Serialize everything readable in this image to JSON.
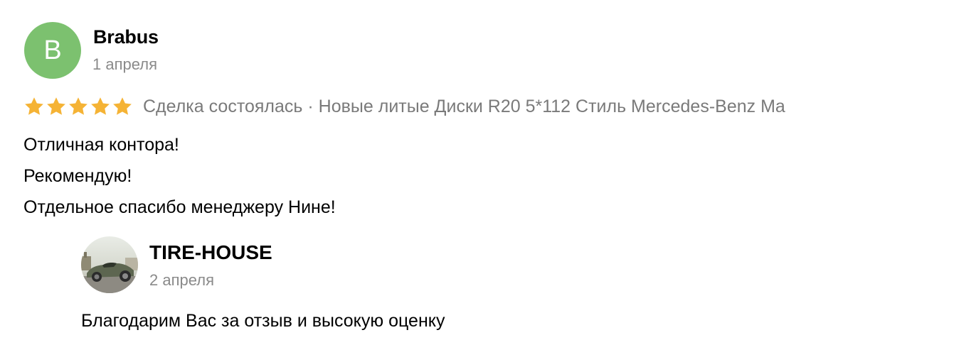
{
  "review": {
    "avatar_letter": "B",
    "author": "Brabus",
    "date": "1 апреля",
    "rating": 5,
    "rating_max": 5,
    "star_color": "#f5b335",
    "avatar_color": "#7cc16f",
    "deal_text": "Сделка состоялась · Новые литые Диски R20 5*112 Стиль Mercedes-Benz Ma",
    "body": [
      "Отличная контора!",
      "Рекомендую!",
      "Отдельное спасибо менеджеру Нине!"
    ]
  },
  "reply": {
    "avatar_icon": "car-photo-avatar",
    "author": "TIRE-HOUSE",
    "date": "2 апреля",
    "text": "Благодарим Вас за отзыв и высокую оценку"
  }
}
